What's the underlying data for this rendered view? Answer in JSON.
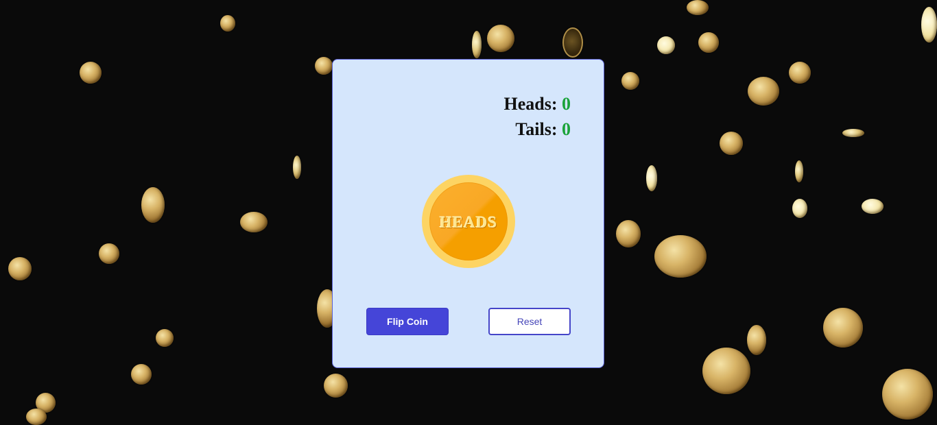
{
  "scoreboard": {
    "heads_label": "Heads: ",
    "heads_count": "0",
    "tails_label": "Tails: ",
    "tails_count": "0"
  },
  "coin": {
    "face_text": "HEADS"
  },
  "buttons": {
    "flip_label": "Flip Coin",
    "reset_label": "Reset"
  },
  "colors": {
    "background": "#0a0a0a",
    "card": "#d5e6fc",
    "accent": "#4545d8",
    "score_value": "#1aa33a",
    "coin_gold": "#f9a825"
  }
}
